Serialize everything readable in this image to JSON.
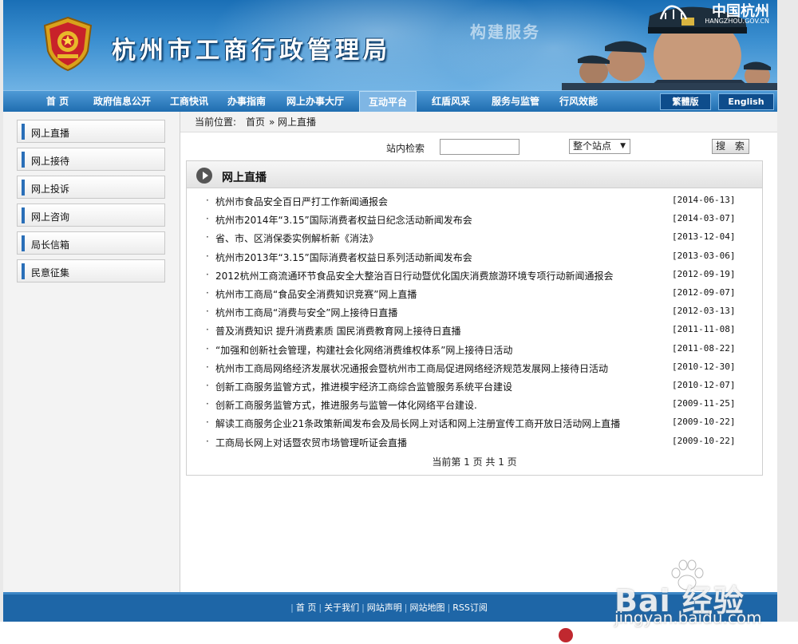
{
  "banner": {
    "title": "杭州市工商行政管理局",
    "slogan": "构建服务",
    "brand_name": "中国杭州",
    "brand_url": "HANGZHOU.GOV.CN"
  },
  "nav": {
    "items": [
      "首 页",
      "政府信息公开",
      "工商快讯",
      "办事指南",
      "网上办事大厅",
      "互动平台",
      "红盾风采",
      "服务与监管",
      "行风效能"
    ],
    "active": "互动平台",
    "lang_traditional": "繁體版",
    "lang_english": "English"
  },
  "sidebar": {
    "items": [
      "网上直播",
      "网上接待",
      "网上投诉",
      "网上咨询",
      "局长信箱",
      "民意征集"
    ]
  },
  "breadcrumb": {
    "label": "当前位置:",
    "home": "首页",
    "sep": "»",
    "current": "网上直播"
  },
  "search": {
    "label": "站内检索",
    "value": "",
    "scope": "整个站点",
    "button": "搜 索"
  },
  "list": {
    "title": "网上直播",
    "bullet": "·",
    "rows": [
      {
        "title": "杭州市食品安全百日严打工作新闻通报会",
        "date": "[2014-06-13]"
      },
      {
        "title": "杭州市2014年“3.15”国际消费者权益日纪念活动新闻发布会",
        "date": "[2014-03-07]"
      },
      {
        "title": "省、市、区消保委实例解析新《消法》",
        "date": "[2013-12-04]"
      },
      {
        "title": "杭州市2013年“3.15”国际消费者权益日系列活动新闻发布会",
        "date": "[2013-03-06]"
      },
      {
        "title": "2012杭州工商流通环节食品安全大整治百日行动暨优化国庆消费旅游环境专项行动新闻通报会",
        "date": "[2012-09-19]"
      },
      {
        "title": "杭州市工商局“食品安全消费知识竞赛”网上直播",
        "date": "[2012-09-07]"
      },
      {
        "title": "杭州市工商局“消费与安全”网上接待日直播",
        "date": "[2012-03-13]"
      },
      {
        "title": "普及消费知识 提升消费素质 国民消费教育网上接待日直播",
        "date": "[2011-11-08]"
      },
      {
        "title": "“加强和创新社会管理，构建社会化网络消费维权体系”网上接待日活动",
        "date": "[2011-08-22]"
      },
      {
        "title": "杭州市工商局网络经济发展状况通报会暨杭州市工商局促进网络经济规范发展网上接待日活动",
        "date": "[2010-12-30]"
      },
      {
        "title": "创新工商服务监管方式，推进模宇经济工商综合监管服务系统平台建设",
        "date": "[2010-12-07]"
      },
      {
        "title": "创新工商服务监管方式，推进服务与监管一体化网络平台建设.",
        "date": "[2009-11-25]"
      },
      {
        "title": "解读工商服务企业21条政策新闻发布会及局长网上对话和网上注册宣传工商开放日活动网上直播",
        "date": "[2009-10-22]"
      },
      {
        "title": "工商局长网上对话暨农贸市场管理听证会直播",
        "date": "[2009-10-22]"
      }
    ],
    "pager": "当前第 1 页 共 1 页"
  },
  "footer": {
    "links": [
      "首 页",
      "关于我们",
      "网站声明",
      "网站地图",
      "RSS订阅"
    ]
  },
  "watermark": {
    "logo": "Bai 经验",
    "url": "jingyan.baidu.com"
  },
  "colors": {
    "banner_blue": "#1a6fb6",
    "nav_blue": "#1f6db0",
    "footer_blue": "#1e66a7",
    "side_marker": "#2a6fb8"
  }
}
